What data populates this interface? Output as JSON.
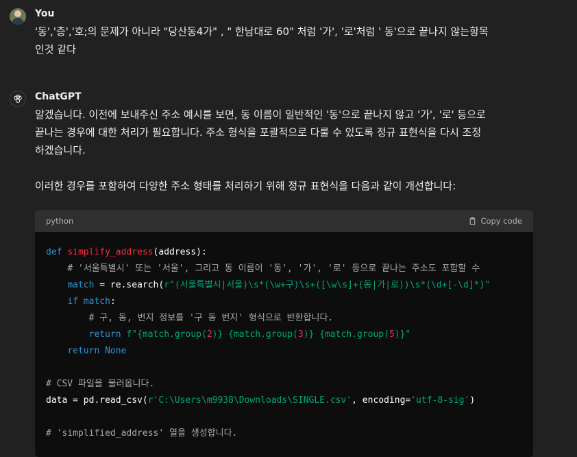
{
  "user": {
    "author": "You",
    "lines": [
      "'동','층','호;의 문제가 아니라 \"당산동4가\" , \" 한남대로 60\" 처럼 '가', '로'처럼 ' 동'으로 끝나지 않는항목",
      "인것 같다"
    ]
  },
  "assistant": {
    "author": "ChatGPT",
    "para1_lines": [
      "알겠습니다. 이전에 보내주신 주소 예시를 보면, 동 이름이 일반적인 '동'으로 끝나지 않고 '가', '로' 등으로",
      "끝나는 경우에 대한 처리가 필요합니다. 주소 형식을 포괄적으로 다룰 수 있도록 정규 표현식을 다시 조정",
      "하겠습니다."
    ],
    "para2": "이러한 경우를 포함하여 다양한 주소 형태를 처리하기 위해 정규 표현식을 다음과 같이 개선합니다:"
  },
  "code": {
    "language": "python",
    "copy_label": "Copy code",
    "lines": [
      [
        {
          "t": "kw",
          "v": "def "
        },
        {
          "t": "fn",
          "v": "simplify_address"
        },
        {
          "t": "plain",
          "v": "(address):"
        }
      ],
      [
        {
          "t": "plain",
          "v": "    "
        },
        {
          "t": "cm",
          "v": "# '서울특별시' 또는 '서울', 그리고 동 이름이 '동', '가', '로' 등으로 끝나는 주소도 포함할 수"
        }
      ],
      [
        {
          "t": "plain",
          "v": "    "
        },
        {
          "t": "kw",
          "v": "match"
        },
        {
          "t": "plain",
          "v": " = re.search("
        },
        {
          "t": "str",
          "v": "r\"(서울특별시|서울)\\s*(\\w+구)\\s+([\\w\\s]+(동|가|로))\\s*(\\d+[-\\d]*)\""
        }
      ],
      [
        {
          "t": "plain",
          "v": "    "
        },
        {
          "t": "kw",
          "v": "if match"
        },
        {
          "t": "plain",
          "v": ":"
        }
      ],
      [
        {
          "t": "plain",
          "v": "        "
        },
        {
          "t": "cm",
          "v": "# 구, 동, 번지 정보를 '구 동 번지' 형식으로 반환합니다."
        }
      ],
      [
        {
          "t": "plain",
          "v": "        "
        },
        {
          "t": "kw",
          "v": "return "
        },
        {
          "t": "str",
          "v": "f\"{match.group("
        },
        {
          "t": "num",
          "v": "2"
        },
        {
          "t": "str",
          "v": ")} {match.group("
        },
        {
          "t": "num",
          "v": "3"
        },
        {
          "t": "str",
          "v": ")} {match.group("
        },
        {
          "t": "num",
          "v": "5"
        },
        {
          "t": "str",
          "v": ")}\""
        }
      ],
      [
        {
          "t": "plain",
          "v": "    "
        },
        {
          "t": "kw",
          "v": "return None"
        }
      ],
      [
        {
          "t": "plain",
          "v": ""
        }
      ],
      [
        {
          "t": "cm",
          "v": "# CSV 파일을 불러옵니다."
        }
      ],
      [
        {
          "t": "plain",
          "v": "data = pd.read_csv("
        },
        {
          "t": "str",
          "v": "r'C:\\Users\\m9938\\Downloads\\SINGLE.csv'"
        },
        {
          "t": "plain",
          "v": ", encoding="
        },
        {
          "t": "str",
          "v": "'utf-8-sig'"
        },
        {
          "t": "plain",
          "v": ")"
        }
      ],
      [
        {
          "t": "plain",
          "v": ""
        }
      ],
      [
        {
          "t": "cm",
          "v": "# 'simplified_address' 열을 생성합니다."
        }
      ]
    ]
  }
}
